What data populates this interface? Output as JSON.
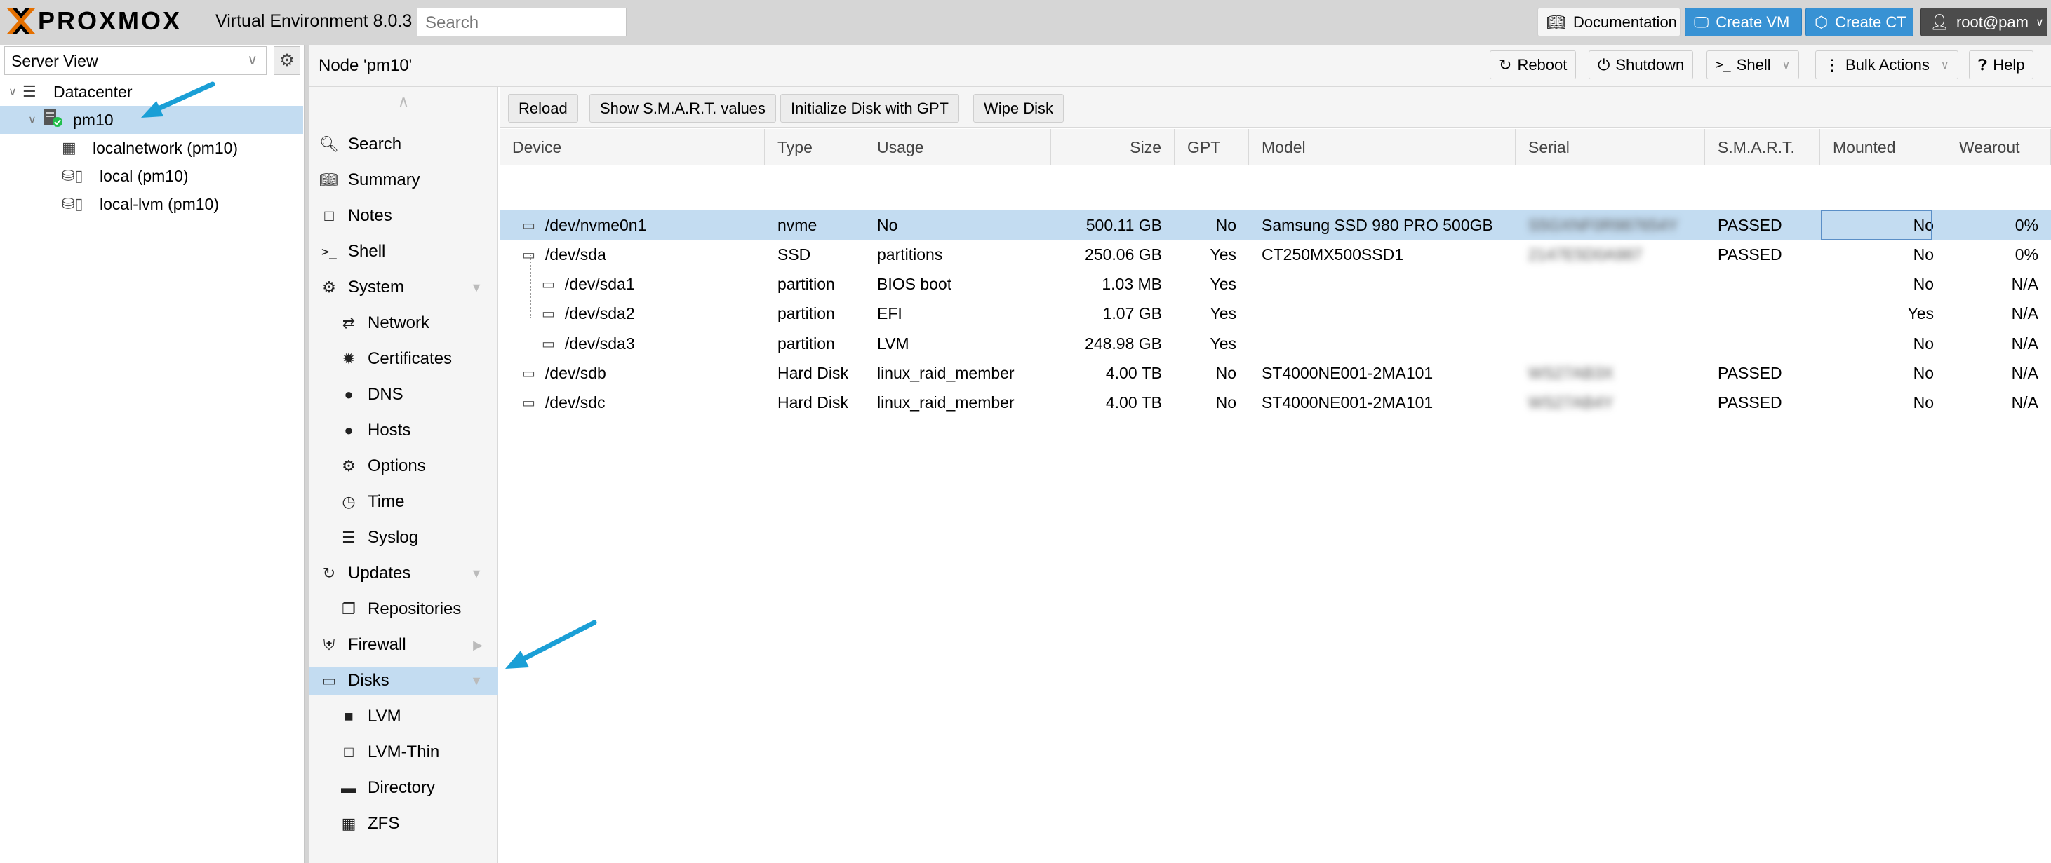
{
  "topbar": {
    "logo_text": "PROXMOX",
    "product": "Virtual Environment 8.0.3",
    "search_placeholder": "Search",
    "documentation": "Documentation",
    "create_vm": "Create VM",
    "create_ct": "Create CT",
    "user": "root@pam"
  },
  "tree": {
    "view": "Server View",
    "items": [
      {
        "label": "Datacenter"
      },
      {
        "label": "pm10"
      },
      {
        "label": "localnetwork (pm10)"
      },
      {
        "label": "local (pm10)"
      },
      {
        "label": "local-lvm (pm10)"
      }
    ]
  },
  "node": {
    "title": "Node 'pm10'",
    "reboot": "Reboot",
    "shutdown": "Shutdown",
    "shell": "Shell",
    "bulk_actions": "Bulk Actions",
    "help": "Help"
  },
  "nav": [
    {
      "label": "Search",
      "icon": "search-icon"
    },
    {
      "label": "Summary",
      "icon": "book-icon"
    },
    {
      "label": "Notes",
      "icon": "note-icon"
    },
    {
      "label": "Shell",
      "icon": "terminal-icon"
    },
    {
      "label": "System",
      "icon": "gears-icon"
    },
    {
      "label": "Network",
      "icon": "exchange-icon"
    },
    {
      "label": "Certificates",
      "icon": "certificate-icon"
    },
    {
      "label": "DNS",
      "icon": "globe-icon"
    },
    {
      "label": "Hosts",
      "icon": "globe-icon"
    },
    {
      "label": "Options",
      "icon": "gear-icon"
    },
    {
      "label": "Time",
      "icon": "clock-icon"
    },
    {
      "label": "Syslog",
      "icon": "list-icon"
    },
    {
      "label": "Updates",
      "icon": "refresh-icon"
    },
    {
      "label": "Repositories",
      "icon": "files-icon"
    },
    {
      "label": "Firewall",
      "icon": "shield-icon"
    },
    {
      "label": "Disks",
      "icon": "hdd-icon"
    },
    {
      "label": "LVM",
      "icon": "square-icon"
    },
    {
      "label": "LVM-Thin",
      "icon": "square-outline-icon"
    },
    {
      "label": "Directory",
      "icon": "folder-icon"
    },
    {
      "label": "ZFS",
      "icon": "grid-icon"
    }
  ],
  "disks_toolbar": {
    "reload": "Reload",
    "smart": "Show S.M.A.R.T. values",
    "init_gpt": "Initialize Disk with GPT",
    "wipe": "Wipe Disk"
  },
  "columns": [
    "Device",
    "Type",
    "Usage",
    "Size",
    "GPT",
    "Model",
    "Serial",
    "S.M.A.R.T.",
    "Mounted",
    "Wearout"
  ],
  "rows": [
    {
      "device": "/dev/nvme0n1",
      "type": "nvme",
      "usage": "No",
      "size": "500.11 GB",
      "gpt": "No",
      "model": "Samsung SSD 980 PRO 500GB",
      "serial": "S5GXNF0R987654Y",
      "smart": "PASSED",
      "mounted": "No",
      "wearout": "0%"
    },
    {
      "device": "/dev/sda",
      "type": "SSD",
      "usage": "partitions",
      "size": "250.06 GB",
      "gpt": "Yes",
      "model": "CT250MX500SSD1",
      "serial": "2147E5D0A987",
      "smart": "PASSED",
      "mounted": "No",
      "wearout": "0%"
    },
    {
      "device": "/dev/sda1",
      "type": "partition",
      "usage": "BIOS boot",
      "size": "1.03 MB",
      "gpt": "Yes",
      "model": "",
      "serial": "",
      "smart": "",
      "mounted": "No",
      "wearout": "N/A"
    },
    {
      "device": "/dev/sda2",
      "type": "partition",
      "usage": "EFI",
      "size": "1.07 GB",
      "gpt": "Yes",
      "model": "",
      "serial": "",
      "smart": "",
      "mounted": "Yes",
      "wearout": "N/A"
    },
    {
      "device": "/dev/sda3",
      "type": "partition",
      "usage": "LVM",
      "size": "248.98 GB",
      "gpt": "Yes",
      "model": "",
      "serial": "",
      "smart": "",
      "mounted": "No",
      "wearout": "N/A"
    },
    {
      "device": "/dev/sdb",
      "type": "Hard Disk",
      "usage": "linux_raid_member",
      "size": "4.00 TB",
      "gpt": "No",
      "model": "ST4000NE001-2MA101",
      "serial": "WS27AB3X",
      "smart": "PASSED",
      "mounted": "No",
      "wearout": "N/A"
    },
    {
      "device": "/dev/sdc",
      "type": "Hard Disk",
      "usage": "linux_raid_member",
      "size": "4.00 TB",
      "gpt": "No",
      "model": "ST4000NE001-2MA101",
      "serial": "WS27AB4Y",
      "smart": "PASSED",
      "mounted": "No",
      "wearout": "N/A"
    }
  ],
  "colors": {
    "accent": "#3892d4",
    "selection": "#c3dcf1",
    "arrow": "#1a9fd6",
    "logo_orange": "#e57000"
  }
}
